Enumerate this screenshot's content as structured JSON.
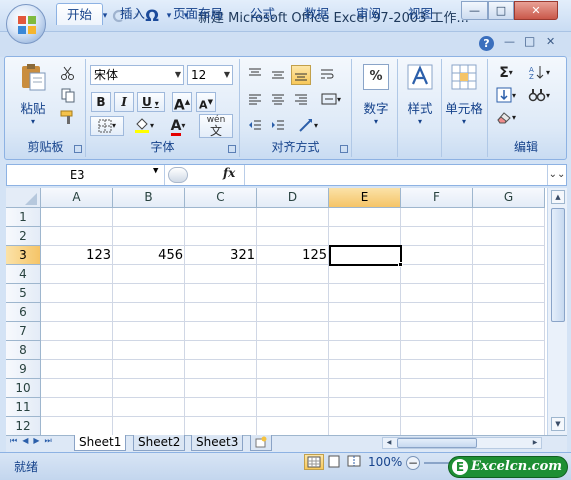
{
  "window": {
    "title": "新建 Microsoft Office Excel 97-2003 工作...",
    "min_label": "—",
    "max_label": "□",
    "close_label": "✕"
  },
  "qat": {
    "save_icon": "save-icon",
    "undo_icon": "undo-icon",
    "redo_icon": "redo-icon",
    "symbol_label": "Ω",
    "dropdown": "▾"
  },
  "tabs": [
    {
      "label": "开始",
      "active": true
    },
    {
      "label": "插入"
    },
    {
      "label": "页面布局"
    },
    {
      "label": "公式"
    },
    {
      "label": "数据"
    },
    {
      "label": "审阅"
    },
    {
      "label": "视图"
    }
  ],
  "ribbon_controls": {
    "help": "?",
    "min": "—",
    "restore": "□",
    "close": "✕"
  },
  "clipboard": {
    "paste_label": "粘贴",
    "group_label": "剪贴板"
  },
  "font": {
    "name": "宋体",
    "size": "12",
    "bold": "B",
    "italic": "I",
    "underline": "U",
    "grow": "A",
    "shrink": "A",
    "font_color": "A",
    "phonetic": "wén",
    "phonetic_char": "文",
    "group_label": "字体"
  },
  "alignment": {
    "group_label": "对齐方式"
  },
  "number": {
    "label": "数字",
    "symbol": "%"
  },
  "styles": {
    "label": "样式"
  },
  "cells": {
    "label": "单元格"
  },
  "editing": {
    "label": "编辑",
    "sum": "Σ"
  },
  "formula_bar": {
    "name_box": "E3",
    "fx": "fx",
    "formula": ""
  },
  "columns": [
    "A",
    "B",
    "C",
    "D",
    "E",
    "F",
    "G"
  ],
  "selected_column": "E",
  "rows": [
    "1",
    "2",
    "3",
    "4",
    "5",
    "6",
    "7",
    "8",
    "9",
    "10",
    "11",
    "12"
  ],
  "selected_row": "3",
  "cell_values": {
    "A3": "123",
    "B3": "456",
    "C3": "321",
    "D3": "125"
  },
  "sheets": [
    {
      "label": "Sheet1",
      "active": true
    },
    {
      "label": "Sheet2"
    },
    {
      "label": "Sheet3"
    }
  ],
  "status": {
    "ready": "就绪",
    "zoom": "100%",
    "watermark": "Excelcn.com",
    "watermark_badge": "E"
  }
}
